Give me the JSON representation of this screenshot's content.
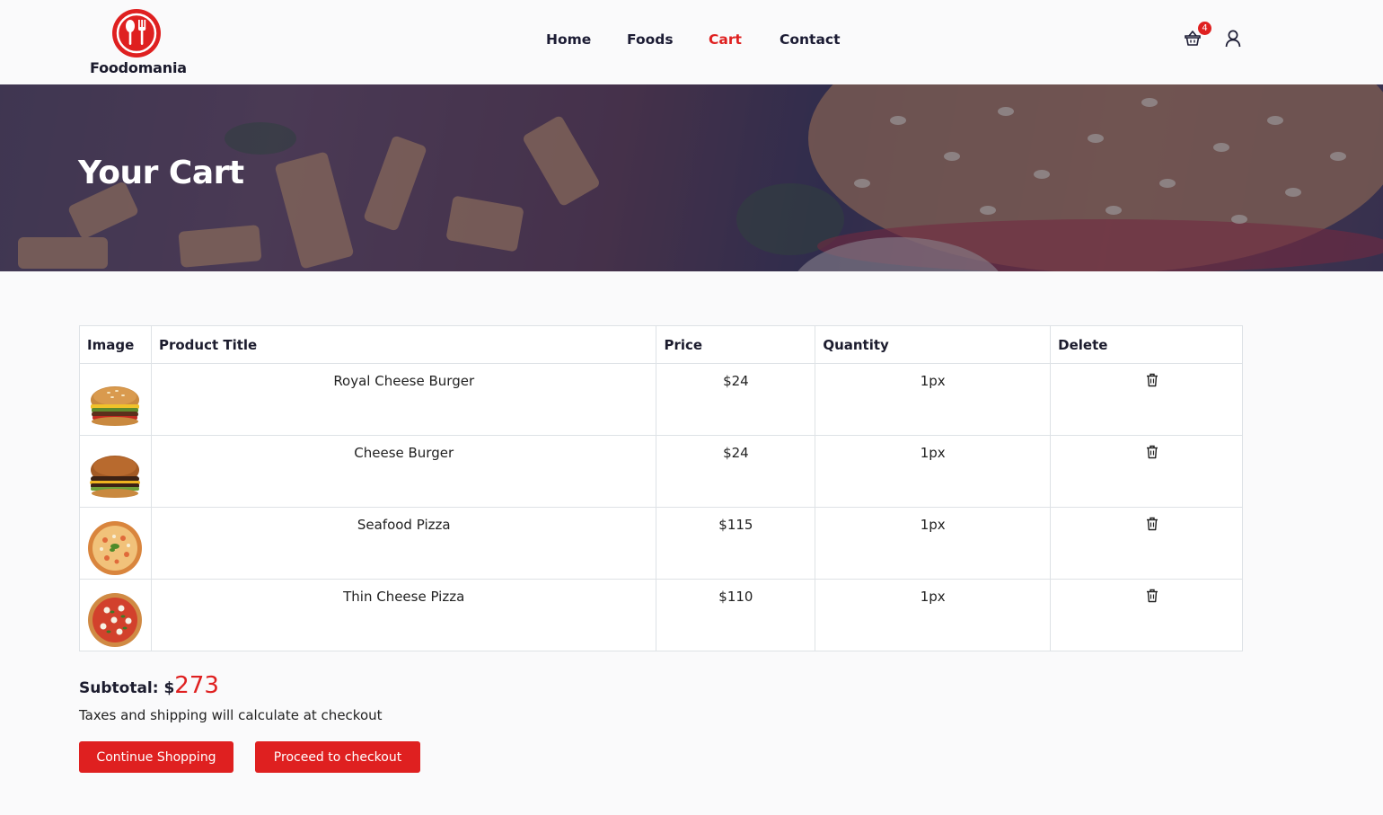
{
  "brand": {
    "name": "Foodomania",
    "color": "#df2020"
  },
  "nav": {
    "items": [
      {
        "label": "Home",
        "active": false
      },
      {
        "label": "Foods",
        "active": false
      },
      {
        "label": "Cart",
        "active": true
      },
      {
        "label": "Contact",
        "active": false
      }
    ]
  },
  "header_icons": {
    "cart_icon": "shopping-basket-icon",
    "cart_count": "4",
    "user_icon": "user-icon"
  },
  "hero": {
    "title": "Your Cart"
  },
  "table": {
    "headers": [
      "Image",
      "Product Title",
      "Price",
      "Quantity",
      "Delete"
    ],
    "rows": [
      {
        "image": "burger-image",
        "title": "Royal Cheese Burger",
        "price": "$24",
        "quantity": "1px",
        "delete_icon": "trash-icon"
      },
      {
        "image": "burger-image",
        "title": "Cheese Burger",
        "price": "$24",
        "quantity": "1px",
        "delete_icon": "trash-icon"
      },
      {
        "image": "pizza-image",
        "title": "Seafood Pizza",
        "price": "$115",
        "quantity": "1px",
        "delete_icon": "trash-icon"
      },
      {
        "image": "pizza-image",
        "title": "Thin Cheese Pizza",
        "price": "$110",
        "quantity": "1px",
        "delete_icon": "trash-icon"
      }
    ]
  },
  "summary": {
    "subtotal_label": "Subtotal: $",
    "subtotal_value": "273",
    "note": "Taxes and shipping will calculate at checkout"
  },
  "buttons": {
    "continue": "Continue Shopping",
    "checkout": "Proceed to checkout"
  }
}
